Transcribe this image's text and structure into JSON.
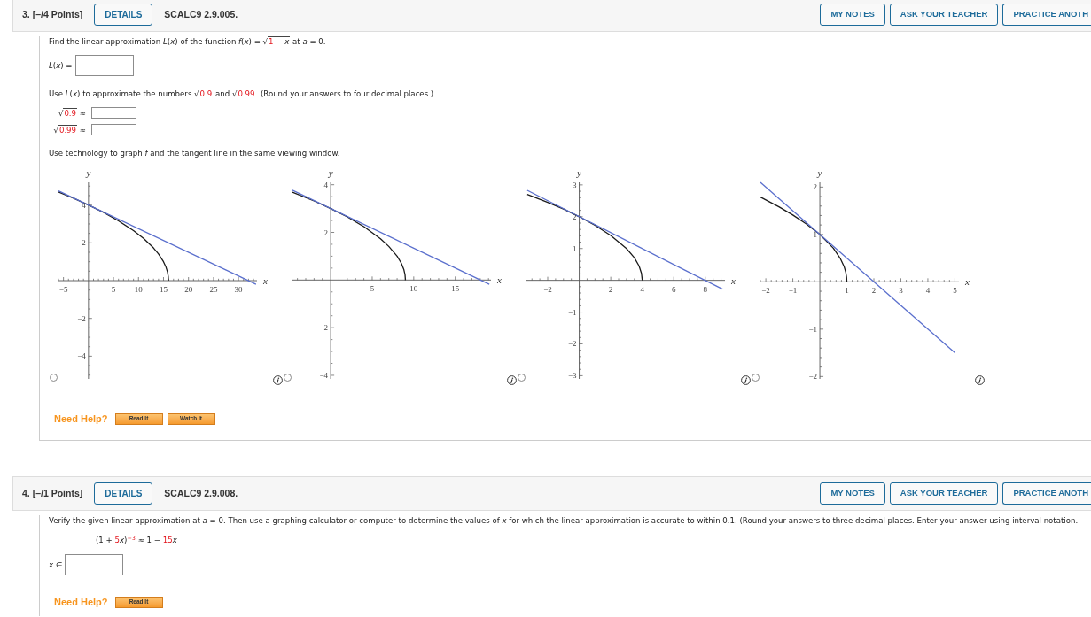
{
  "problems": [
    {
      "heading": "3. [–/4 Points]",
      "details_button": "DETAILS",
      "code": "SCALC9 2.9.005.",
      "actions": [
        "MY NOTES",
        "ASK YOUR TEACHER",
        "PRACTICE ANOTH"
      ],
      "parts": [
        {
          "kind": "prompt",
          "segments": [
            {
              "kind": "text",
              "text": "Find the linear approximation *L*(*x*) of the function *f*(*x*) = "
            },
            {
              "kind": "sqrt",
              "sign": "√",
              "parts": [
                {
                  "kind": "red",
                  "text": "1"
                },
                {
                  "kind": "text",
                  "text": " − *x*"
                }
              ]
            },
            {
              "kind": "text",
              "text": " at *a* = 0."
            }
          ]
        },
        {
          "kind": "answer",
          "label": [
            {
              "kind": "text",
              "text": "*L*(*x*) ="
            }
          ]
        },
        {
          "kind": "prompt",
          "segments": [
            {
              "kind": "text",
              "text": "Use *L*(*x*) to approximate the numbers "
            },
            {
              "kind": "sqrt",
              "sign": "√",
              "parts": [
                {
                  "kind": "red",
                  "text": "0.9"
                }
              ]
            },
            {
              "kind": "text",
              "text": " and "
            },
            {
              "kind": "sqrt",
              "sign": "√",
              "parts": [
                {
                  "kind": "red",
                  "text": "0.99"
                }
              ]
            },
            {
              "kind": "text",
              "text": ". (Round your answers to four decimal places.)"
            }
          ]
        },
        {
          "kind": "approx_list",
          "items": [
            {
              "label": [
                {
                  "kind": "sqrt",
                  "sign": "√",
                  "parts": [
                    {
                      "kind": "red",
                      "text": "0.9"
                    }
                  ]
                },
                {
                  "kind": "text",
                  "text": " ≈"
                }
              ]
            },
            {
              "label": [
                {
                  "kind": "sqrt",
                  "sign": "√",
                  "parts": [
                    {
                      "kind": "red",
                      "text": "0.99"
                    }
                  ]
                },
                {
                  "kind": "text",
                  "text": " ≈"
                }
              ]
            }
          ]
        },
        {
          "kind": "prompt",
          "segments": [
            {
              "kind": "text",
              "text": "Use technology to graph *f* and the tangent line in the same viewing window."
            }
          ]
        },
        {
          "kind": "graph_choices",
          "options": [
            {
              "selected": false,
              "chart_data": {
                "type": "line",
                "xlabel": "x",
                "ylabel": "y",
                "xlim": [
                  -6,
                  33.7
                ],
                "ylim": [
                  -5.2,
                  5.2
                ],
                "xticks": [
                  {
                    "value": -5,
                    "label": "−5"
                  },
                  5,
                  10,
                  15,
                  20,
                  25,
                  30
                ],
                "yticks": [
                  {
                    "value": -4,
                    "label": "−4"
                  },
                  {
                    "value": -2,
                    "label": "−2"
                  },
                  2,
                  4
                ],
                "series": [
                  {
                    "color": "#1a1a1a",
                    "x": [
                      -6,
                      -3,
                      0,
                      3,
                      6,
                      9,
                      11,
                      13,
                      14,
                      15,
                      15.5,
                      15.8,
                      15.95,
                      16
                    ],
                    "values": [
                      4.69,
                      4.36,
                      4,
                      3.61,
                      3.16,
                      2.65,
                      2.24,
                      1.73,
                      1.41,
                      1,
                      0.71,
                      0.45,
                      0.22,
                      0
                    ]
                  },
                  {
                    "color": "#5a6fcd",
                    "x": [
                      -6,
                      33.5
                    ],
                    "values": [
                      4.75,
                      -0.19
                    ]
                  }
                ]
              }
            },
            {
              "selected": false,
              "chart_data": {
                "type": "line",
                "xlabel": "x",
                "ylabel": "y",
                "xlim": [
                  -4.6,
                  19.3
                ],
                "ylim": [
                  -4.15,
                  4.1
                ],
                "xticks": [
                  5,
                  10,
                  15
                ],
                "yticks": [
                  {
                    "value": -4,
                    "label": "−4"
                  },
                  {
                    "value": -2,
                    "label": "−2"
                  },
                  2,
                  4
                ],
                "series": [
                  {
                    "color": "#1a1a1a",
                    "x": [
                      -4.6,
                      -2,
                      0,
                      2,
                      4,
                      6,
                      7,
                      8,
                      8.5,
                      8.8,
                      8.95,
                      9
                    ],
                    "values": [
                      3.69,
                      3.32,
                      3,
                      2.65,
                      2.24,
                      1.73,
                      1.41,
                      1,
                      0.71,
                      0.45,
                      0.22,
                      0
                    ]
                  },
                  {
                    "color": "#5a6fcd",
                    "x": [
                      -4.6,
                      19.1
                    ],
                    "values": [
                      3.77,
                      -0.18
                    ]
                  }
                ]
              }
            },
            {
              "selected": false,
              "chart_data": {
                "type": "line",
                "xlabel": "x",
                "ylabel": "y",
                "xlim": [
                  -3.35,
                  9.25
                ],
                "ylim": [
                  -3.1,
                  3.08
                ],
                "xticks": [
                  {
                    "value": -2,
                    "label": "−2"
                  },
                  2,
                  4,
                  6,
                  8
                ],
                "yticks": [
                  {
                    "value": -3,
                    "label": "−3"
                  },
                  {
                    "value": -2,
                    "label": "−2"
                  },
                  {
                    "value": -1,
                    "label": "−1"
                  },
                  1,
                  2,
                  3
                ],
                "series": [
                  {
                    "color": "#1a1a1a",
                    "x": [
                      -3.3,
                      -2,
                      -1,
                      0,
                      1,
                      2,
                      3,
                      3.5,
                      3.8,
                      3.95,
                      4
                    ],
                    "values": [
                      2.7,
                      2.45,
                      2.24,
                      2,
                      1.73,
                      1.41,
                      1,
                      0.71,
                      0.45,
                      0.22,
                      0
                    ]
                  },
                  {
                    "color": "#5a6fcd",
                    "x": [
                      -3.3,
                      9.1
                    ],
                    "values": [
                      2.83,
                      -0.28
                    ]
                  }
                ]
              }
            },
            {
              "selected": false,
              "chart_data": {
                "type": "line",
                "xlabel": "x",
                "ylabel": "y",
                "xlim": [
                  -2.2,
                  5.15
                ],
                "ylim": [
                  -2.05,
                  2.1
                ],
                "xticks": [
                  {
                    "value": -2,
                    "label": "−2"
                  },
                  {
                    "value": -1,
                    "label": "−1"
                  },
                  1,
                  2,
                  3,
                  4,
                  5
                ],
                "yticks": [
                  {
                    "value": -2,
                    "label": "−2"
                  },
                  {
                    "value": -1,
                    "label": "−1"
                  },
                  1,
                  2
                ],
                "series": [
                  {
                    "color": "#1a1a1a",
                    "x": [
                      -2.2,
                      -1.5,
                      -1,
                      -0.5,
                      0,
                      0.5,
                      0.75,
                      0.9,
                      0.96,
                      0.99,
                      1
                    ],
                    "values": [
                      1.79,
                      1.58,
                      1.41,
                      1.22,
                      1,
                      0.71,
                      0.5,
                      0.32,
                      0.2,
                      0.1,
                      0
                    ]
                  },
                  {
                    "color": "#5a6fcd",
                    "x": [
                      -2.2,
                      5
                    ],
                    "values": [
                      2.1,
                      -1.5
                    ]
                  }
                ]
              }
            }
          ]
        },
        {
          "kind": "help",
          "label": "Need Help?",
          "buttons": [
            "Read It",
            "Watch It"
          ]
        }
      ]
    },
    {
      "heading": "4. [–/1 Points]",
      "details_button": "DETAILS",
      "code": "SCALC9 2.9.008.",
      "actions": [
        "MY NOTES",
        "ASK YOUR TEACHER",
        "PRACTICE ANOTH"
      ],
      "parts": [
        {
          "kind": "prompt",
          "segments": [
            {
              "kind": "text",
              "text": "Verify the given linear approximation at *a* = 0. Then use a graphing calculator or computer to determine the values of *x* for which the linear approximation is accurate to within 0.1. (Round your answers to three decimal places. Enter your answer using interval notation."
            }
          ]
        },
        {
          "kind": "formula",
          "segments": [
            {
              "kind": "text",
              "text": "(1 + "
            },
            {
              "kind": "red",
              "text": "5"
            },
            {
              "kind": "text",
              "text": "*x*)"
            },
            {
              "kind": "red_sup",
              "text": "−3"
            },
            {
              "kind": "text",
              "text": " ≈ 1 − "
            },
            {
              "kind": "red",
              "text": "15"
            },
            {
              "kind": "text",
              "text": "*x*"
            }
          ]
        },
        {
          "kind": "answer",
          "label": [
            {
              "kind": "text",
              "text": "*x* ∈"
            }
          ]
        },
        {
          "kind": "help",
          "label": "Need Help?",
          "buttons": [
            "Read It"
          ]
        }
      ]
    }
  ]
}
